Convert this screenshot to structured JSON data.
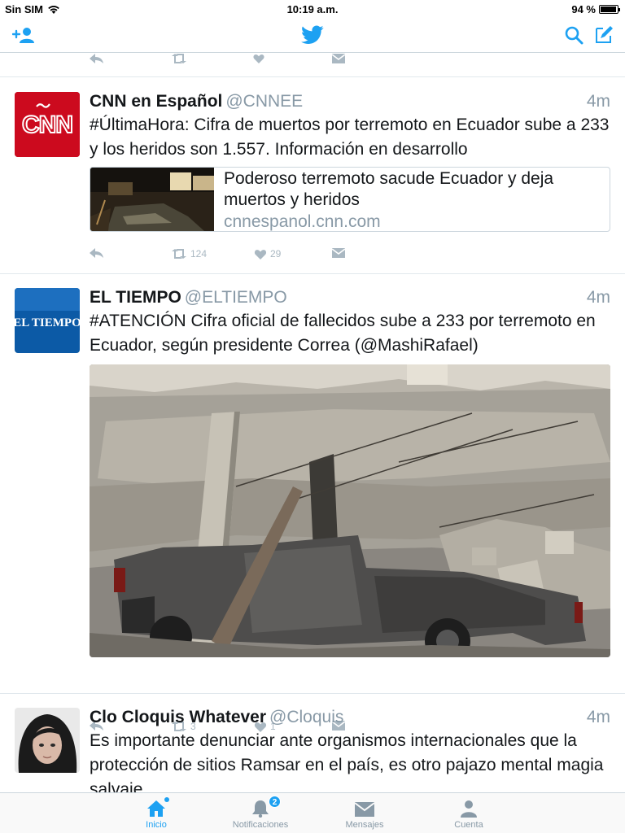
{
  "status_bar": {
    "carrier": "Sin SIM",
    "time": "10:19 a.m.",
    "battery": "94 %",
    "battery_level": 0.94
  },
  "nav": {
    "add_user_icon": "add-user-icon",
    "logo_icon": "twitter-bird-icon",
    "search_icon": "search-icon",
    "compose_icon": "compose-icon"
  },
  "colors": {
    "accent": "#1da1f2",
    "secondary_text": "#8899a6",
    "action_gray": "#aab8c2",
    "divider": "#e1e8ed"
  },
  "tweets": [
    {
      "name": "CNN en Español",
      "handle": "@CNNEE",
      "time": "4m",
      "avatar_text": "CNN",
      "text": "#ÚltimaHora: Cifra de muertos por terremoto en Ecuador sube a 233 y los heridos son 1.557. Información en desarrollo",
      "card": {
        "title": "Poderoso terremoto sacude Ecuador y deja muertos y heridos",
        "domain": "cnnespanol.cnn.com"
      },
      "retweets": "124",
      "likes": "29"
    },
    {
      "name": "EL TIEMPO",
      "handle": "@ELTIEMPO",
      "time": "4m",
      "avatar_text": "EL TIEMPO",
      "text": "#ATENCIÓN Cifra oficial de fallecidos sube a 233 por terremoto en Ecuador, según presidente Correa (@MashiRafael)",
      "retweets": "3",
      "likes": "1"
    },
    {
      "name": "Clo Cloquis Whatever",
      "handle": "@Cloquis",
      "time": "4m",
      "text": "Es importante denunciar ante organismos internacionales que la protección de sitios Ramsar en el país, es otro pajazo mental magia salvaje"
    }
  ],
  "tabs": [
    {
      "label": "Inicio",
      "icon": "home-icon"
    },
    {
      "label": "Notificaciones",
      "icon": "bell-icon",
      "badge": "2"
    },
    {
      "label": "Mensajes",
      "icon": "envelope-icon"
    },
    {
      "label": "Cuenta",
      "icon": "person-icon"
    }
  ]
}
